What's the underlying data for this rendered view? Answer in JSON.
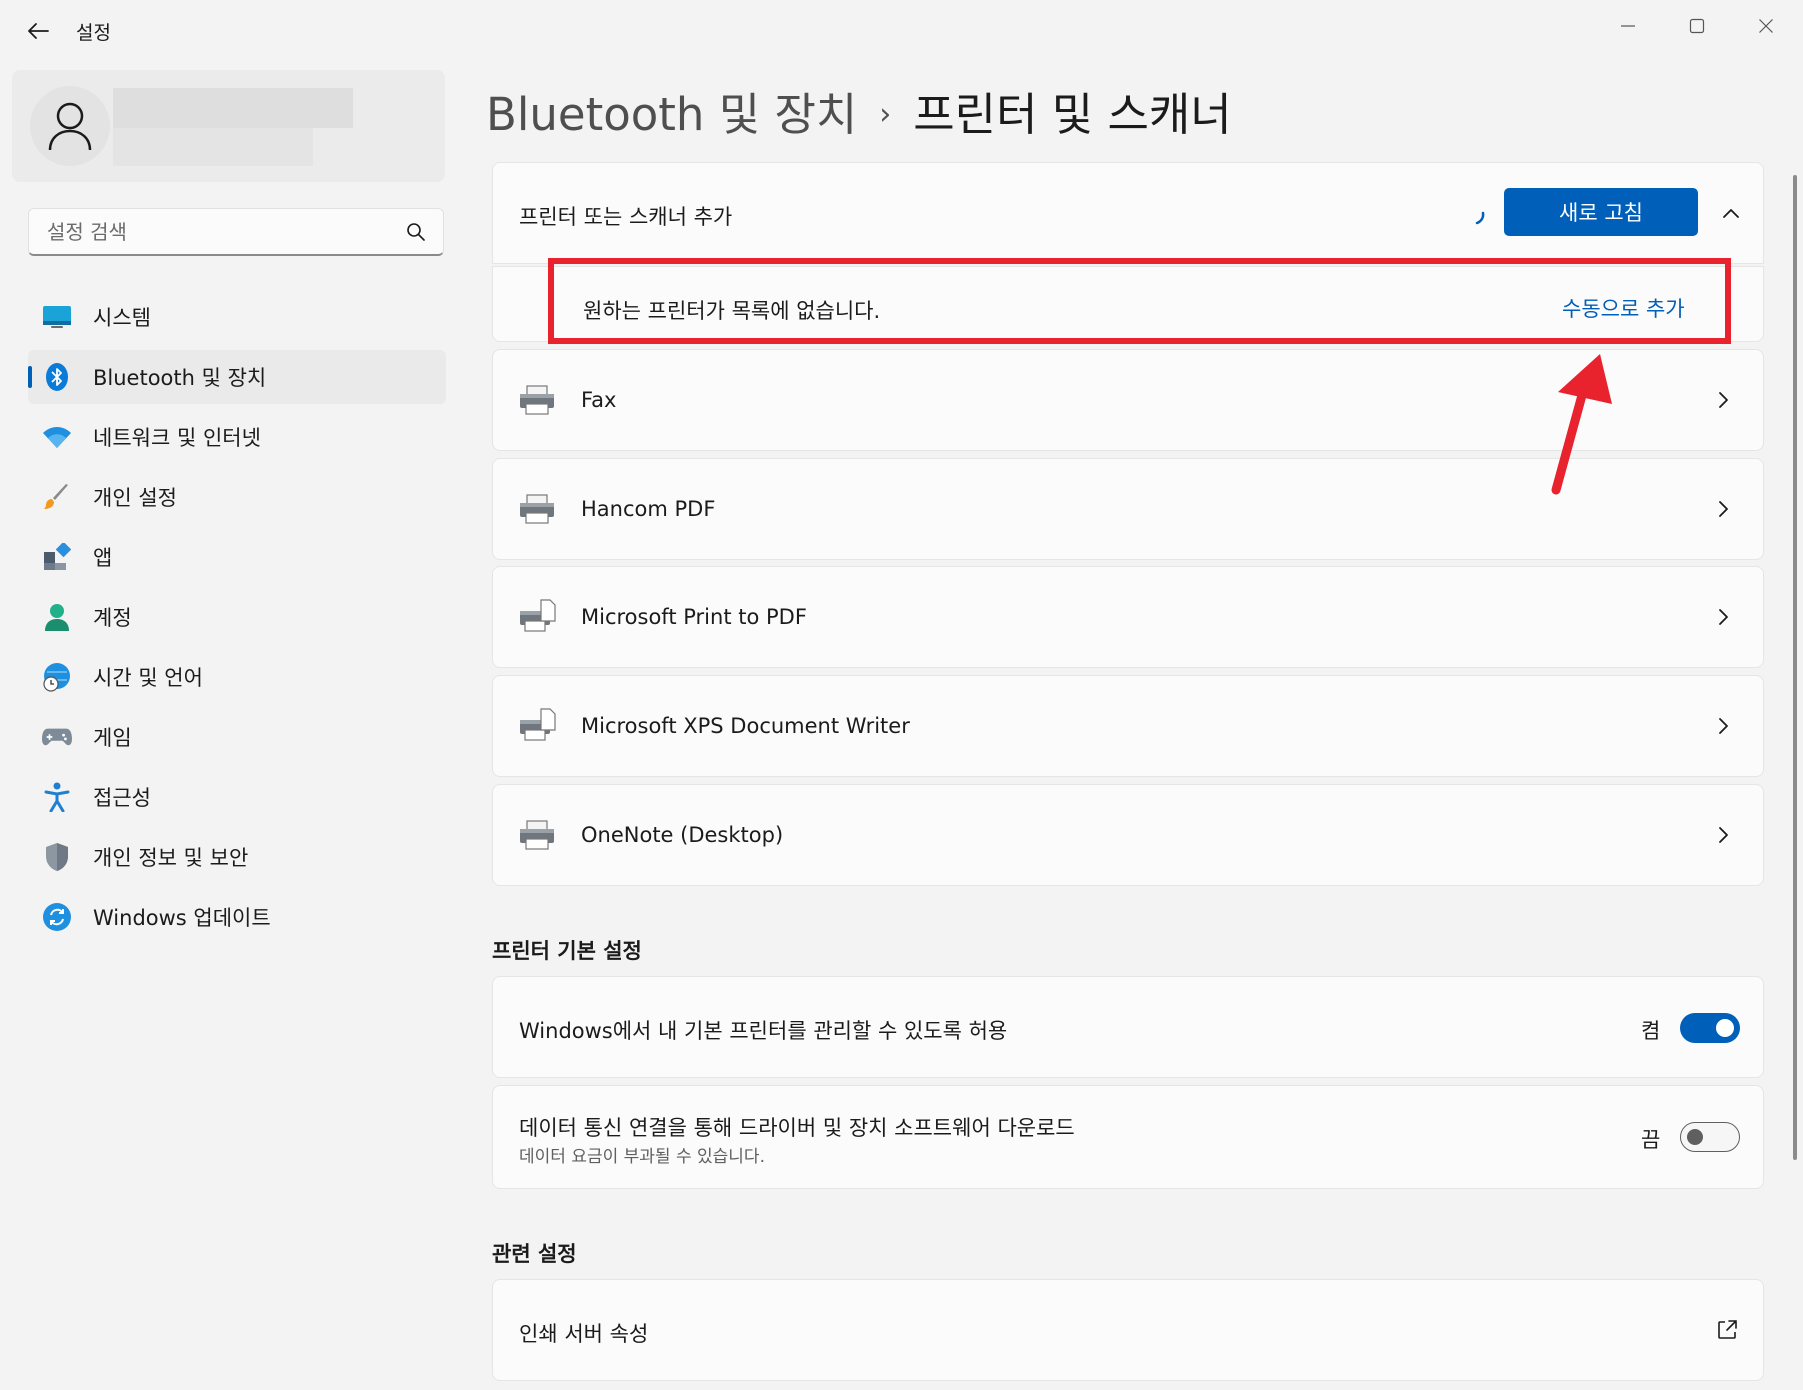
{
  "titlebar": {
    "title": "설정",
    "icons": {
      "back": "arrow-left",
      "minimize": "minimize",
      "maximize": "maximize",
      "close": "close"
    }
  },
  "profile": {
    "icon": "user-icon"
  },
  "search": {
    "placeholder": "설정 검색",
    "value": "",
    "icon": "search-icon"
  },
  "sidebar": {
    "items": [
      {
        "label": "시스템",
        "icon": "system-icon",
        "active": false
      },
      {
        "label": "Bluetooth 및 장치",
        "icon": "bluetooth-icon",
        "active": true
      },
      {
        "label": "네트워크 및 인터넷",
        "icon": "wifi-icon",
        "active": false
      },
      {
        "label": "개인 설정",
        "icon": "brush-icon",
        "active": false
      },
      {
        "label": "앱",
        "icon": "apps-icon",
        "active": false
      },
      {
        "label": "계정",
        "icon": "account-icon",
        "active": false
      },
      {
        "label": "시간 및 언어",
        "icon": "globe-clock-icon",
        "active": false
      },
      {
        "label": "게임",
        "icon": "gamepad-icon",
        "active": false
      },
      {
        "label": "접근성",
        "icon": "accessibility-icon",
        "active": false
      },
      {
        "label": "개인 정보 및 보안",
        "icon": "shield-icon",
        "active": false
      },
      {
        "label": "Windows 업데이트",
        "icon": "update-icon",
        "active": false
      }
    ]
  },
  "breadcrumb": {
    "parent": "Bluetooth 및 장치",
    "separator": "›",
    "current": "프린터 및 스캐너"
  },
  "add_printer": {
    "label": "프린터 또는 스캐너 추가",
    "refresh_button": "새로 고침",
    "manual_text": "원하는 프린터가 목록에 없습니다.",
    "manual_link": "수동으로 추가"
  },
  "devices": [
    {
      "name": "Fax",
      "icon": "printer-icon"
    },
    {
      "name": "Hancom PDF",
      "icon": "printer-icon"
    },
    {
      "name": "Microsoft Print to PDF",
      "icon": "printer-doc-icon"
    },
    {
      "name": "Microsoft XPS Document Writer",
      "icon": "printer-doc-icon"
    },
    {
      "name": "OneNote (Desktop)",
      "icon": "printer-icon"
    }
  ],
  "printer_prefs": {
    "title": "프린터 기본 설정",
    "items": [
      {
        "label": "Windows에서 내 기본 프린터를 관리할 수 있도록 허용",
        "sub": "",
        "state": "켬",
        "on": true
      },
      {
        "label": "데이터 통신 연결을 통해 드라이버 및 장치 소프트웨어 다운로드",
        "sub": "데이터 요금이 부과될 수 있습니다.",
        "state": "끔",
        "on": false
      }
    ]
  },
  "related": {
    "title": "관련 설정",
    "items": [
      {
        "label": "인쇄 서버 속성",
        "icon": "external-link-icon"
      }
    ]
  },
  "colors": {
    "accent": "#005fb8",
    "highlight": "#e8232d",
    "background": "#f3f3f3",
    "card": "#fbfbfb"
  }
}
